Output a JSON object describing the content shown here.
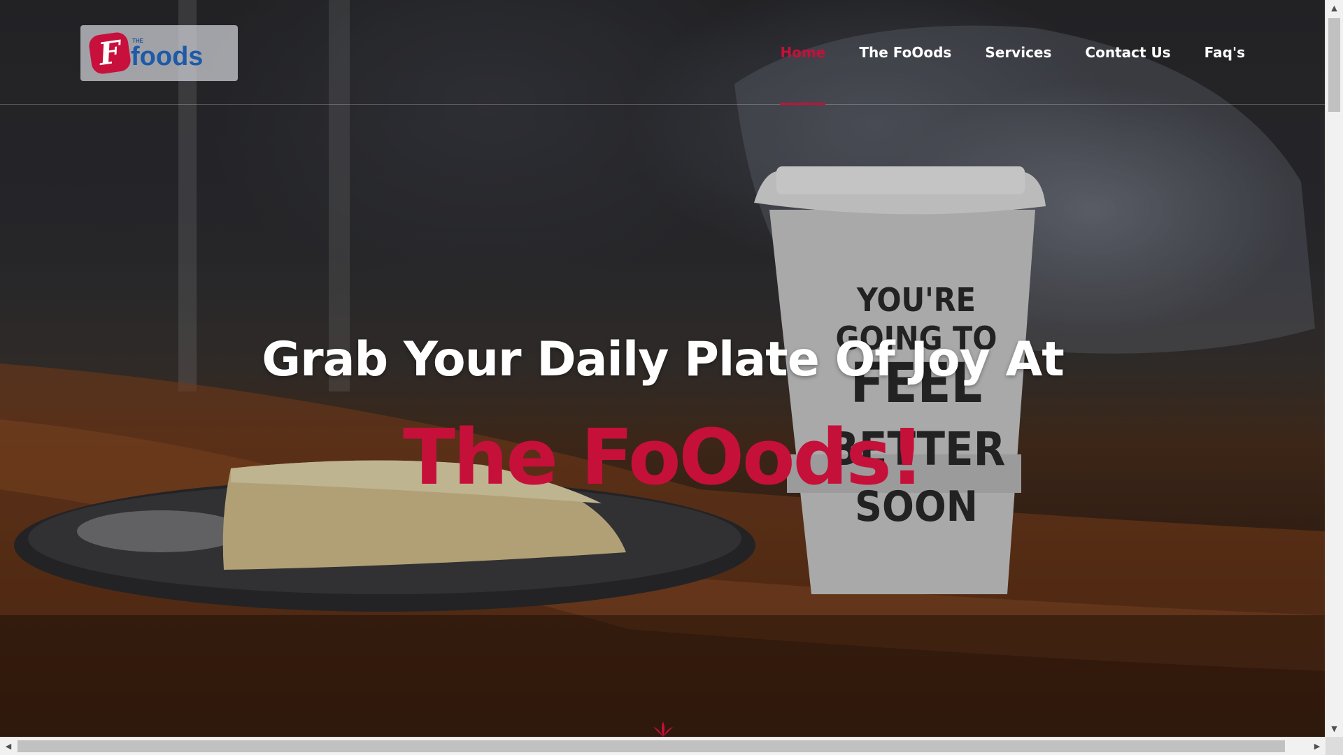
{
  "brand": {
    "logo_small_text": "THE",
    "logo_letter": "F",
    "logo_word": "foods"
  },
  "nav": {
    "items": [
      {
        "label": "Home",
        "active": true
      },
      {
        "label": "The FoOods",
        "active": false
      },
      {
        "label": "Services",
        "active": false
      },
      {
        "label": "Contact Us",
        "active": false
      },
      {
        "label": "Faq's",
        "active": false
      }
    ]
  },
  "hero": {
    "headline": "Grab Your Daily Plate Of Joy At",
    "brand_line": "The FoOods!",
    "cup_text": [
      "YOU'RE",
      "GOING TO",
      "FEEL",
      "BETTER",
      "SOON"
    ]
  },
  "theme": {
    "accent": "#c5103a",
    "logo_blue": "#1e5aa8",
    "text_light": "#ffffff"
  },
  "icons": {
    "scroll_indicator": "lotus-icon",
    "scroll_up": "arrow-up-icon",
    "scroll_down": "arrow-down-icon",
    "scroll_left": "arrow-left-icon",
    "scroll_right": "arrow-right-icon"
  }
}
